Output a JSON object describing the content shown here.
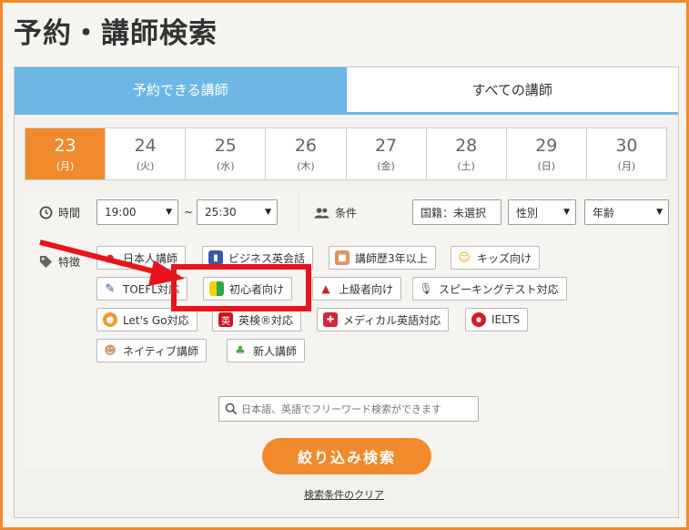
{
  "page": {
    "title": "予約・講師検索"
  },
  "tabs": [
    {
      "label": "予約できる講師",
      "active": true
    },
    {
      "label": "すべての講師",
      "active": false
    }
  ],
  "dates": [
    {
      "day": "23",
      "weekday": "(月)",
      "selected": true
    },
    {
      "day": "24",
      "weekday": "(火)"
    },
    {
      "day": "25",
      "weekday": "(水)"
    },
    {
      "day": "26",
      "weekday": "(木)"
    },
    {
      "day": "27",
      "weekday": "(金)"
    },
    {
      "day": "28",
      "weekday": "(土)"
    },
    {
      "day": "29",
      "weekday": "(日)"
    },
    {
      "day": "30",
      "weekday": "(月)"
    }
  ],
  "time": {
    "label": "時間",
    "from": "19:00",
    "separator": "~",
    "to": "25:30"
  },
  "conditions": {
    "label": "条件",
    "nationality": "国籍：未選択",
    "gender": "性別",
    "age": "年齢"
  },
  "features": {
    "label": "特徴",
    "tags": [
      "日本人講師",
      "ビジネス英会話",
      "講師歴3年以上",
      "キッズ向け",
      "TOEFL対応",
      "初心者向け",
      "上級者向け",
      "スピーキングテスト対応",
      "Let's Go対応",
      "英検®対応",
      "メディカル英語対応",
      "IELTS",
      "ネイティブ講師",
      "新人講師"
    ]
  },
  "search": {
    "placeholder": "日本語、英語でフリーワード検索ができます",
    "submit_label": "絞り込み検索",
    "clear_label": "検索条件のクリア"
  },
  "colors": {
    "accent": "#f08a2c",
    "tab_active": "#6cb7e6",
    "highlight": "#e8131b"
  }
}
